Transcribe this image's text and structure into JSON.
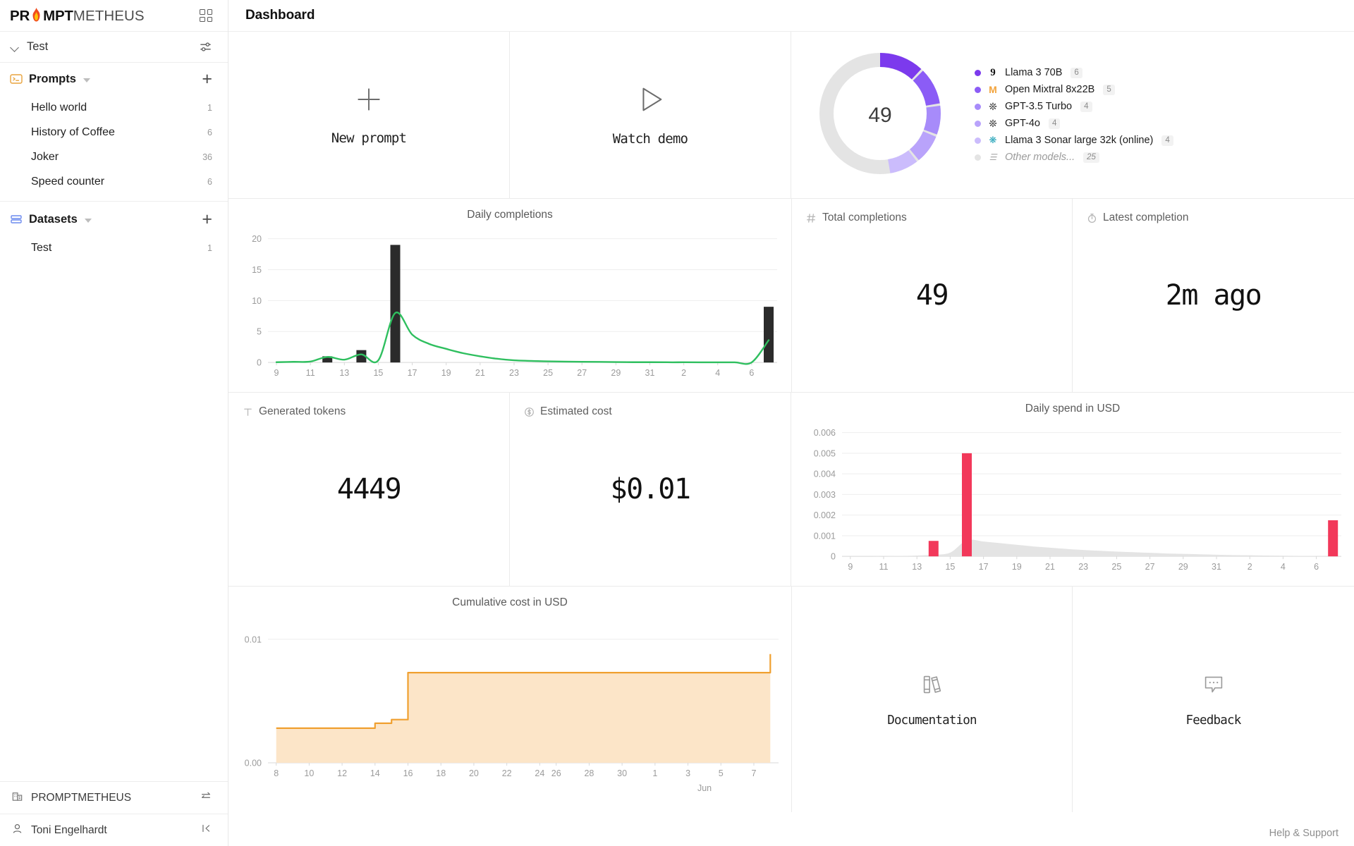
{
  "brand": {
    "part1": "PR",
    "part2": "MPT",
    "part3": "METHEUS",
    "flame_icon": "flame-icon",
    "grid_icon": "grid-apps-icon"
  },
  "workspace": {
    "name": "Test",
    "chevron_icon": "chevron-down-icon",
    "settings_icon": "sliders-icon"
  },
  "sidebar": {
    "sections": [
      {
        "title": "Prompts",
        "icon": "terminal-prompt-icon",
        "add_label": "+",
        "items": [
          {
            "label": "Hello world",
            "count": "1"
          },
          {
            "label": "History of Coffee",
            "count": "6"
          },
          {
            "label": "Joker",
            "count": "36"
          },
          {
            "label": "Speed counter",
            "count": "6"
          }
        ]
      },
      {
        "title": "Datasets",
        "icon": "dataset-stack-icon",
        "add_label": "+",
        "items": [
          {
            "label": "Test",
            "count": "1"
          }
        ]
      }
    ],
    "footer": [
      {
        "label": "PROMPTMETHEUS",
        "icon": "organization-icon",
        "right_icon": "switch-arrows-icon"
      },
      {
        "label": "Toni Engelhardt",
        "icon": "user-icon",
        "right_icon": "collapse-left-icon"
      }
    ]
  },
  "header": {
    "title": "Dashboard"
  },
  "actions": {
    "new_prompt": {
      "label": "New prompt",
      "icon": "plus-icon"
    },
    "watch_demo": {
      "label": "Watch demo",
      "icon": "play-icon"
    },
    "documentation": {
      "label": "Documentation",
      "icon": "books-icon"
    },
    "feedback": {
      "label": "Feedback",
      "icon": "chat-bubble-icon"
    }
  },
  "stats": {
    "total_completions": {
      "label": "Total completions",
      "icon": "hash-icon",
      "value": "49"
    },
    "latest_completion": {
      "label": "Latest completion",
      "icon": "stopwatch-icon",
      "value": "2m ago"
    },
    "generated_tokens": {
      "label": "Generated tokens",
      "icon": "text-t-icon",
      "value": "4449"
    },
    "estimated_cost": {
      "label": "Estimated cost",
      "icon": "dollar-circle-icon",
      "value": "$0.01"
    }
  },
  "help": {
    "label": "Help & Support"
  },
  "colors": {
    "accent_purple": "#7c4dff",
    "completions_line": "#2fbf5f",
    "completions_bar": "#2b2b2b",
    "spend_bar": "#f2385a",
    "cumulative_line": "#f0a030",
    "cumulative_fill": "#fce5c8",
    "donut_track": "#e6e6e6"
  },
  "chart_data": [
    {
      "id": "model_donut",
      "type": "pie",
      "title": "",
      "center_label": "49",
      "total": 49,
      "legend_position": "right",
      "categories": [
        "Llama 3 70B",
        "Open Mixtral 8x22B",
        "GPT-3.5 Turbo",
        "GPT-4o",
        "Llama 3 Sonar large 32k (online)",
        "Other models..."
      ],
      "values": [
        6,
        5,
        4,
        4,
        4,
        25
      ],
      "colors": [
        "#7c3aed",
        "#8b5cf6",
        "#a78bfa",
        "#b9a3fb",
        "#cbbcfc",
        "#e4e4e4"
      ],
      "legend_icons": [
        "groq-icon",
        "mistral-icon",
        "openai-icon",
        "openai-icon",
        "perplexity-icon",
        "other-models-icon"
      ]
    },
    {
      "id": "daily_completions",
      "type": "bar",
      "title": "Daily completions",
      "xlabel": "",
      "ylabel": "",
      "ylim": [
        0,
        21
      ],
      "yticks": [
        0,
        5,
        10,
        15,
        20
      ],
      "grid": true,
      "x": [
        "9",
        "10",
        "11",
        "12",
        "13",
        "14",
        "15",
        "16",
        "17",
        "18",
        "19",
        "20",
        "21",
        "22",
        "23",
        "24",
        "25",
        "26",
        "27",
        "28",
        "29",
        "30",
        "31",
        "1",
        "2",
        "3",
        "4",
        "5",
        "6",
        "7"
      ],
      "xticks": [
        "9",
        "11",
        "13",
        "15",
        "17",
        "19",
        "21",
        "23",
        "25",
        "27",
        "29",
        "31",
        "2",
        "4",
        "6"
      ],
      "series": [
        {
          "name": "completions",
          "type": "bar",
          "values": [
            0,
            0,
            0,
            1,
            0,
            2,
            0,
            19,
            0,
            0,
            0,
            0,
            0,
            0,
            0,
            0,
            0,
            0,
            0,
            0,
            0,
            0,
            0,
            0,
            0,
            0,
            0,
            0,
            0,
            9
          ]
        },
        {
          "name": "trend",
          "type": "line",
          "values": [
            0.05,
            0.1,
            0.15,
            0.9,
            0.45,
            1.3,
            0.35,
            8.0,
            4.5,
            3.0,
            2.2,
            1.5,
            1.0,
            0.6,
            0.35,
            0.25,
            0.18,
            0.14,
            0.11,
            0.09,
            0.07,
            0.05,
            0.04,
            0.03,
            0.03,
            0.02,
            0.02,
            0.02,
            0.02,
            3.6
          ]
        }
      ]
    },
    {
      "id": "daily_spend",
      "type": "bar",
      "title": "Daily spend in USD",
      "xlabel": "",
      "ylabel": "",
      "ylim": [
        0,
        0.0063
      ],
      "yticks": [
        0,
        0.001,
        0.002,
        0.003,
        0.004,
        0.005,
        0.006
      ],
      "ytick_labels": [
        "0",
        "0.001",
        "0.002",
        "0.003",
        "0.004",
        "0.005",
        "0.006"
      ],
      "grid": true,
      "x": [
        "9",
        "10",
        "11",
        "12",
        "13",
        "14",
        "15",
        "16",
        "17",
        "18",
        "19",
        "20",
        "21",
        "22",
        "23",
        "24",
        "25",
        "26",
        "27",
        "28",
        "29",
        "30",
        "31",
        "1",
        "2",
        "3",
        "4",
        "5",
        "6",
        "7"
      ],
      "xticks": [
        "9",
        "11",
        "13",
        "15",
        "17",
        "19",
        "21",
        "23",
        "25",
        "27",
        "29",
        "31",
        "2",
        "4",
        "6"
      ],
      "series": [
        {
          "name": "spend",
          "type": "bar",
          "values": [
            0,
            0,
            0,
            0,
            0,
            0.00075,
            0,
            0.005,
            0,
            0,
            0,
            0,
            0,
            0,
            0,
            0,
            0,
            0,
            0,
            0,
            0,
            0,
            0,
            0,
            0,
            0,
            0,
            0,
            0,
            0.00175
          ]
        },
        {
          "name": "trend",
          "type": "area",
          "values": [
            0,
            0,
            0,
            2e-05,
            4e-05,
            8e-05,
            0.00018,
            0.00078,
            0.00072,
            0.00064,
            0.00056,
            0.00048,
            0.00042,
            0.00036,
            0.00031,
            0.00027,
            0.00023,
            0.0002,
            0.00017,
            0.00014,
            0.00012,
            0.0001,
            8e-05,
            6e-05,
            5e-05,
            4e-05,
            3e-05,
            2e-05,
            1e-05,
            1e-05
          ]
        }
      ]
    },
    {
      "id": "cumulative_cost",
      "type": "area",
      "title": "Cumulative cost in USD",
      "xlabel": "Jun",
      "ylabel": "",
      "ylim": [
        0,
        0.0113
      ],
      "yticks": [
        0,
        0.01
      ],
      "ytick_labels": [
        "0.00",
        "0.01"
      ],
      "grid": true,
      "x": [
        "8",
        "9",
        "10",
        "11",
        "12",
        "13",
        "14",
        "15",
        "16",
        "17",
        "18",
        "19",
        "20",
        "21",
        "22",
        "23",
        "24",
        "25",
        "26",
        "27",
        "28",
        "29",
        "30",
        "31",
        "1",
        "2",
        "3",
        "4",
        "5",
        "6",
        "7"
      ],
      "xticks": [
        "8",
        "10",
        "12",
        "14",
        "16",
        "18",
        "20",
        "22",
        "24",
        "26",
        "28",
        "30",
        "1",
        "3",
        "5",
        "7"
      ],
      "values": [
        0.0028,
        0.0028,
        0.0028,
        0.0028,
        0.0028,
        0.0028,
        0.0032,
        0.0035,
        0.0073,
        0.0073,
        0.0073,
        0.0073,
        0.0073,
        0.0073,
        0.0073,
        0.0073,
        0.0073,
        0.0073,
        0.0073,
        0.0073,
        0.0073,
        0.0073,
        0.0073,
        0.0073,
        0.0073,
        0.0073,
        0.0073,
        0.0073,
        0.0073,
        0.0073,
        0.0088
      ]
    }
  ]
}
